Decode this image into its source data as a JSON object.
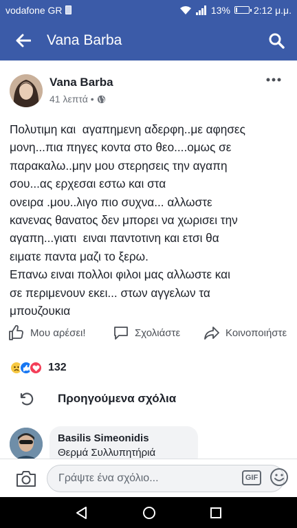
{
  "statusbar": {
    "carrier": "vodafone GR",
    "battery_percent": "13%",
    "battery_level": 0.13,
    "time": "2:12 μ.μ."
  },
  "appbar": {
    "title": "Vana Barba",
    "back_icon": "arrow-left-icon",
    "search_icon": "search-icon"
  },
  "post": {
    "author": "Vana Barba",
    "time_ago": "41 λεπτά",
    "separator": "•",
    "privacy_icon": "globe-icon",
    "text_lines": [
      "Πολυτιμη και  αγαπημενη αδερφη..με αφησες",
      "μονη...πια πηγες κοντα στο θεο....ομως σε",
      "παρακαλω..μην μου στερησεις την αγαπη",
      "σου...ας ερχεσαι εστω και στα",
      "ονειρα .μου..λιγο πιο συχνα... αλλωστε",
      "κανενας θανατος δεν μπορει να χωρισει την",
      "αγαπη...γιατι  ειναι παντοτινη και ετσι θα",
      "ειματε παντα μαζι το ξερω.",
      "Επανω ειναι πολλοι φιλοι μας αλλωστε και",
      "σε περιμενουν εκει... στων αγγελων τα",
      "μπουζουκια"
    ]
  },
  "actions": {
    "like": "Μου αρέσει!",
    "comment": "Σχολιάστε",
    "share": "Κοινοποιήστε"
  },
  "reactions": {
    "icons": [
      "sad-reaction-icon",
      "like-reaction-icon",
      "love-reaction-icon"
    ],
    "count": "132"
  },
  "comments": {
    "previous_label": "Προηγούμενα σχόλια",
    "items": [
      {
        "name": "Basilis Simeonidis",
        "text": "Θερμά Συλλυπητήριά"
      }
    ]
  },
  "composer": {
    "placeholder": "Γράψτε ένα σχόλιο...",
    "gif_label": "GIF"
  },
  "colors": {
    "brand": "#3b5ba8",
    "text": "#1d2129",
    "secondary": "#6b7078"
  }
}
